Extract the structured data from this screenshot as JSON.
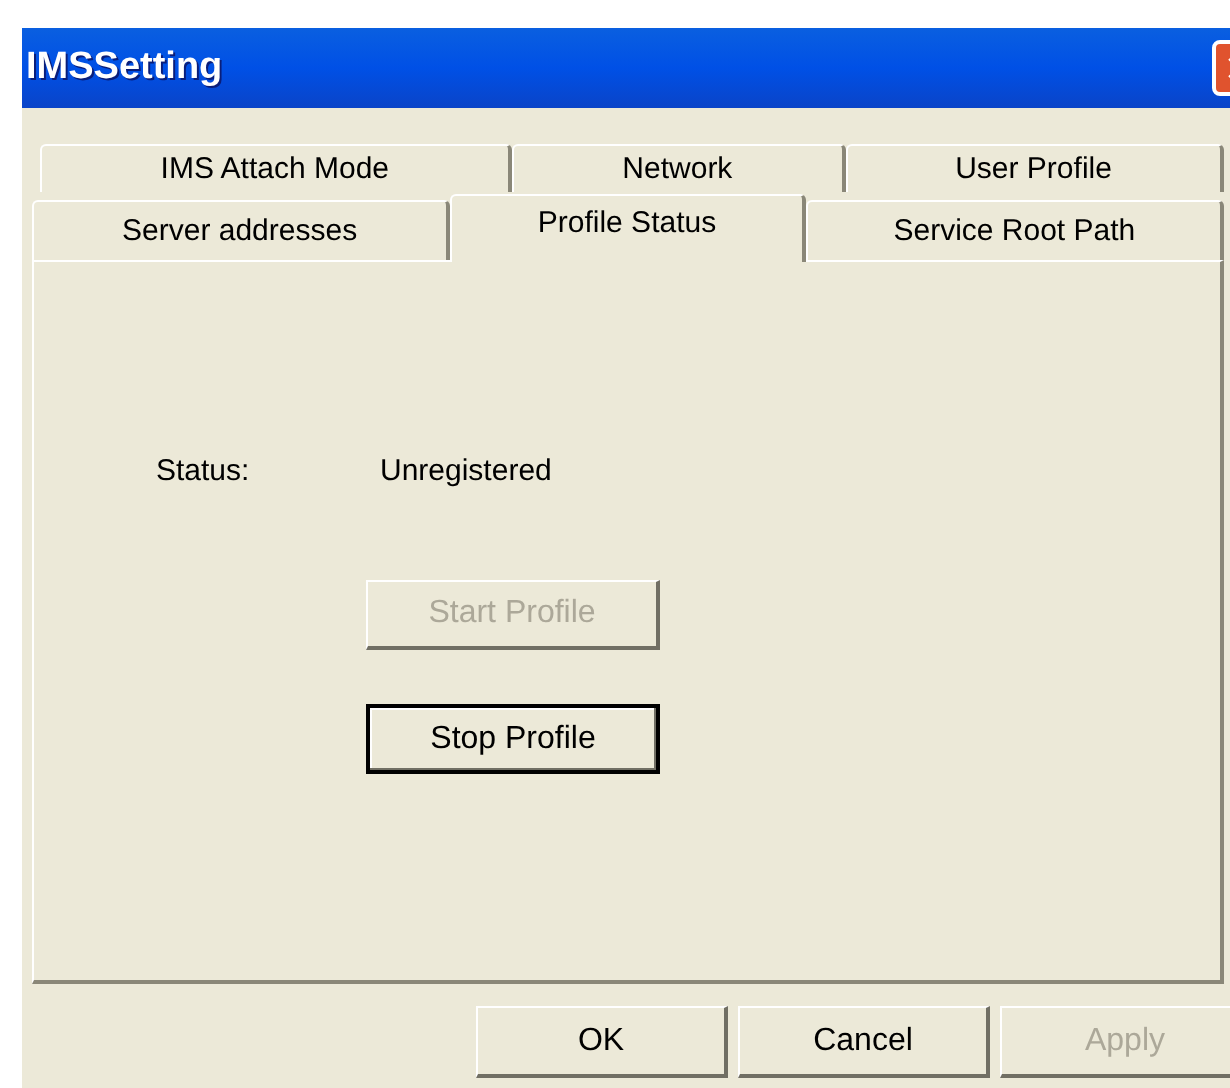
{
  "window": {
    "title": "IMSSetting"
  },
  "tab_rows": [
    {
      "tabs": [
        {
          "label": "IMS Attach Mode",
          "selected": false
        },
        {
          "label": "Network",
          "selected": false
        },
        {
          "label": "User Profile",
          "selected": false
        }
      ]
    },
    {
      "tabs": [
        {
          "label": "Server addresses",
          "selected": false
        },
        {
          "label": "Profile Status",
          "selected": true
        },
        {
          "label": "Service Root Path",
          "selected": false
        }
      ]
    }
  ],
  "status": {
    "label": "Status:",
    "value": "Unregistered"
  },
  "profile_buttons": [
    {
      "label": "Start Profile",
      "disabled": true,
      "default": false
    },
    {
      "label": "Stop Profile",
      "disabled": false,
      "default": true
    }
  ],
  "buttons": [
    {
      "label": "OK",
      "disabled": false,
      "default": false
    },
    {
      "label": "Cancel",
      "disabled": false,
      "default": false
    },
    {
      "label": "Apply",
      "disabled": true,
      "default": false
    }
  ]
}
